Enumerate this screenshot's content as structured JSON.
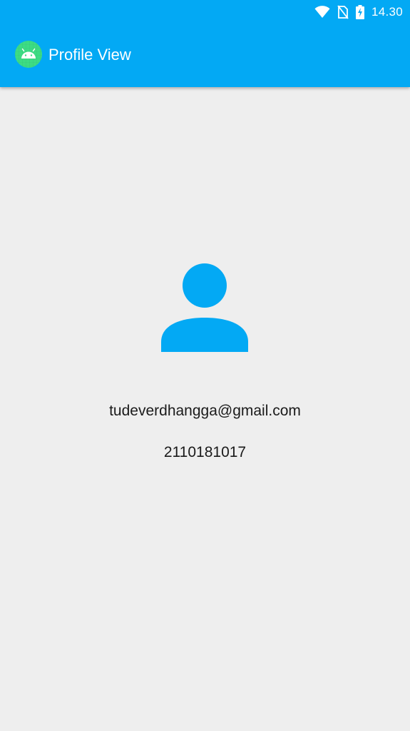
{
  "status_bar": {
    "time": "14.30",
    "icons": [
      "wifi-icon",
      "no-sim-icon",
      "battery-charging-icon"
    ]
  },
  "app_bar": {
    "title": "Profile View",
    "logo_icon": "android-icon",
    "background_color": "#03a9f4"
  },
  "profile": {
    "avatar_icon": "person-icon",
    "avatar_color": "#03a9f4",
    "email": "tudeverdhangga@gmail.com",
    "id_number": "2110181017"
  }
}
